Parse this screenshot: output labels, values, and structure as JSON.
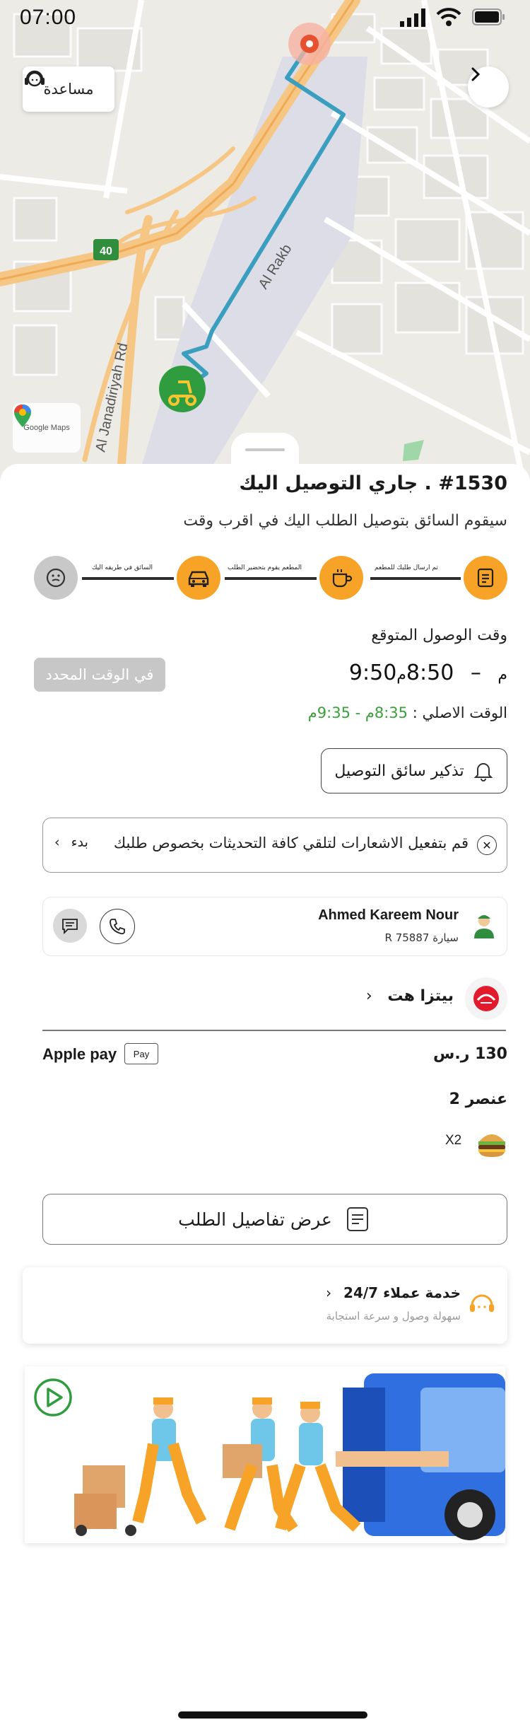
{
  "status_bar": {
    "time": "07:00"
  },
  "map": {
    "help_label": "مساعدة",
    "road_labels": [
      "Al Rakb",
      "Al Janadiriyah Rd"
    ],
    "road_badge": "40",
    "provider_label": "Google Maps"
  },
  "order": {
    "title": "#1530 . جاري التوصيل اليك",
    "subtitle": "سيقوم السائق بتوصيل الطلب اليك في اقرب وقت"
  },
  "progress_steps": [
    {
      "label": "تم ارسال طلبك للمطعم",
      "icon": "receipt-icon",
      "active": true
    },
    {
      "label": "المطعم يقوم بتحضير الطلب",
      "icon": "cup-icon",
      "active": true
    },
    {
      "label": "",
      "icon": "car-icon",
      "active": true
    },
    {
      "label": "السائق في طريقه اليك",
      "icon": "face-icon",
      "active": false
    }
  ],
  "colors": {
    "accent": "#f7a327",
    "green": "#3aa03a",
    "route": "#3a9fbf",
    "inactive": "#c8c8c8"
  },
  "eta": {
    "label": "وقت الوصول المتوقع",
    "from": "8:50",
    "from_suffix": "م",
    "to": "9:50",
    "to_suffix": "م",
    "status_badge": "في الوقت المحدد",
    "original_label": "الوقت الاصلي :",
    "original_value": "8:35م - 9:35م"
  },
  "remind_button": "تذكير سائق التوصيل",
  "notification": {
    "text": "قم بتفعيل الاشعارات لتلقي كافة التحديثات بخصوص طلبك",
    "action": "بدء"
  },
  "driver": {
    "name": "Ahmed Kareem Nour",
    "car": "سيارة R 75887"
  },
  "restaurant": {
    "name": "بيتزا هت"
  },
  "payment": {
    "total": "130 ر.س",
    "method": "Apple pay",
    "badge": "Pay"
  },
  "items": {
    "count_label": "عنصر 2",
    "qty": "X2"
  },
  "details_button": "عرض تفاصيل الطلب",
  "support": {
    "title": "خدمة عملاء 24/7",
    "subtitle": "سهولة وصول و سرعة استجابة"
  }
}
